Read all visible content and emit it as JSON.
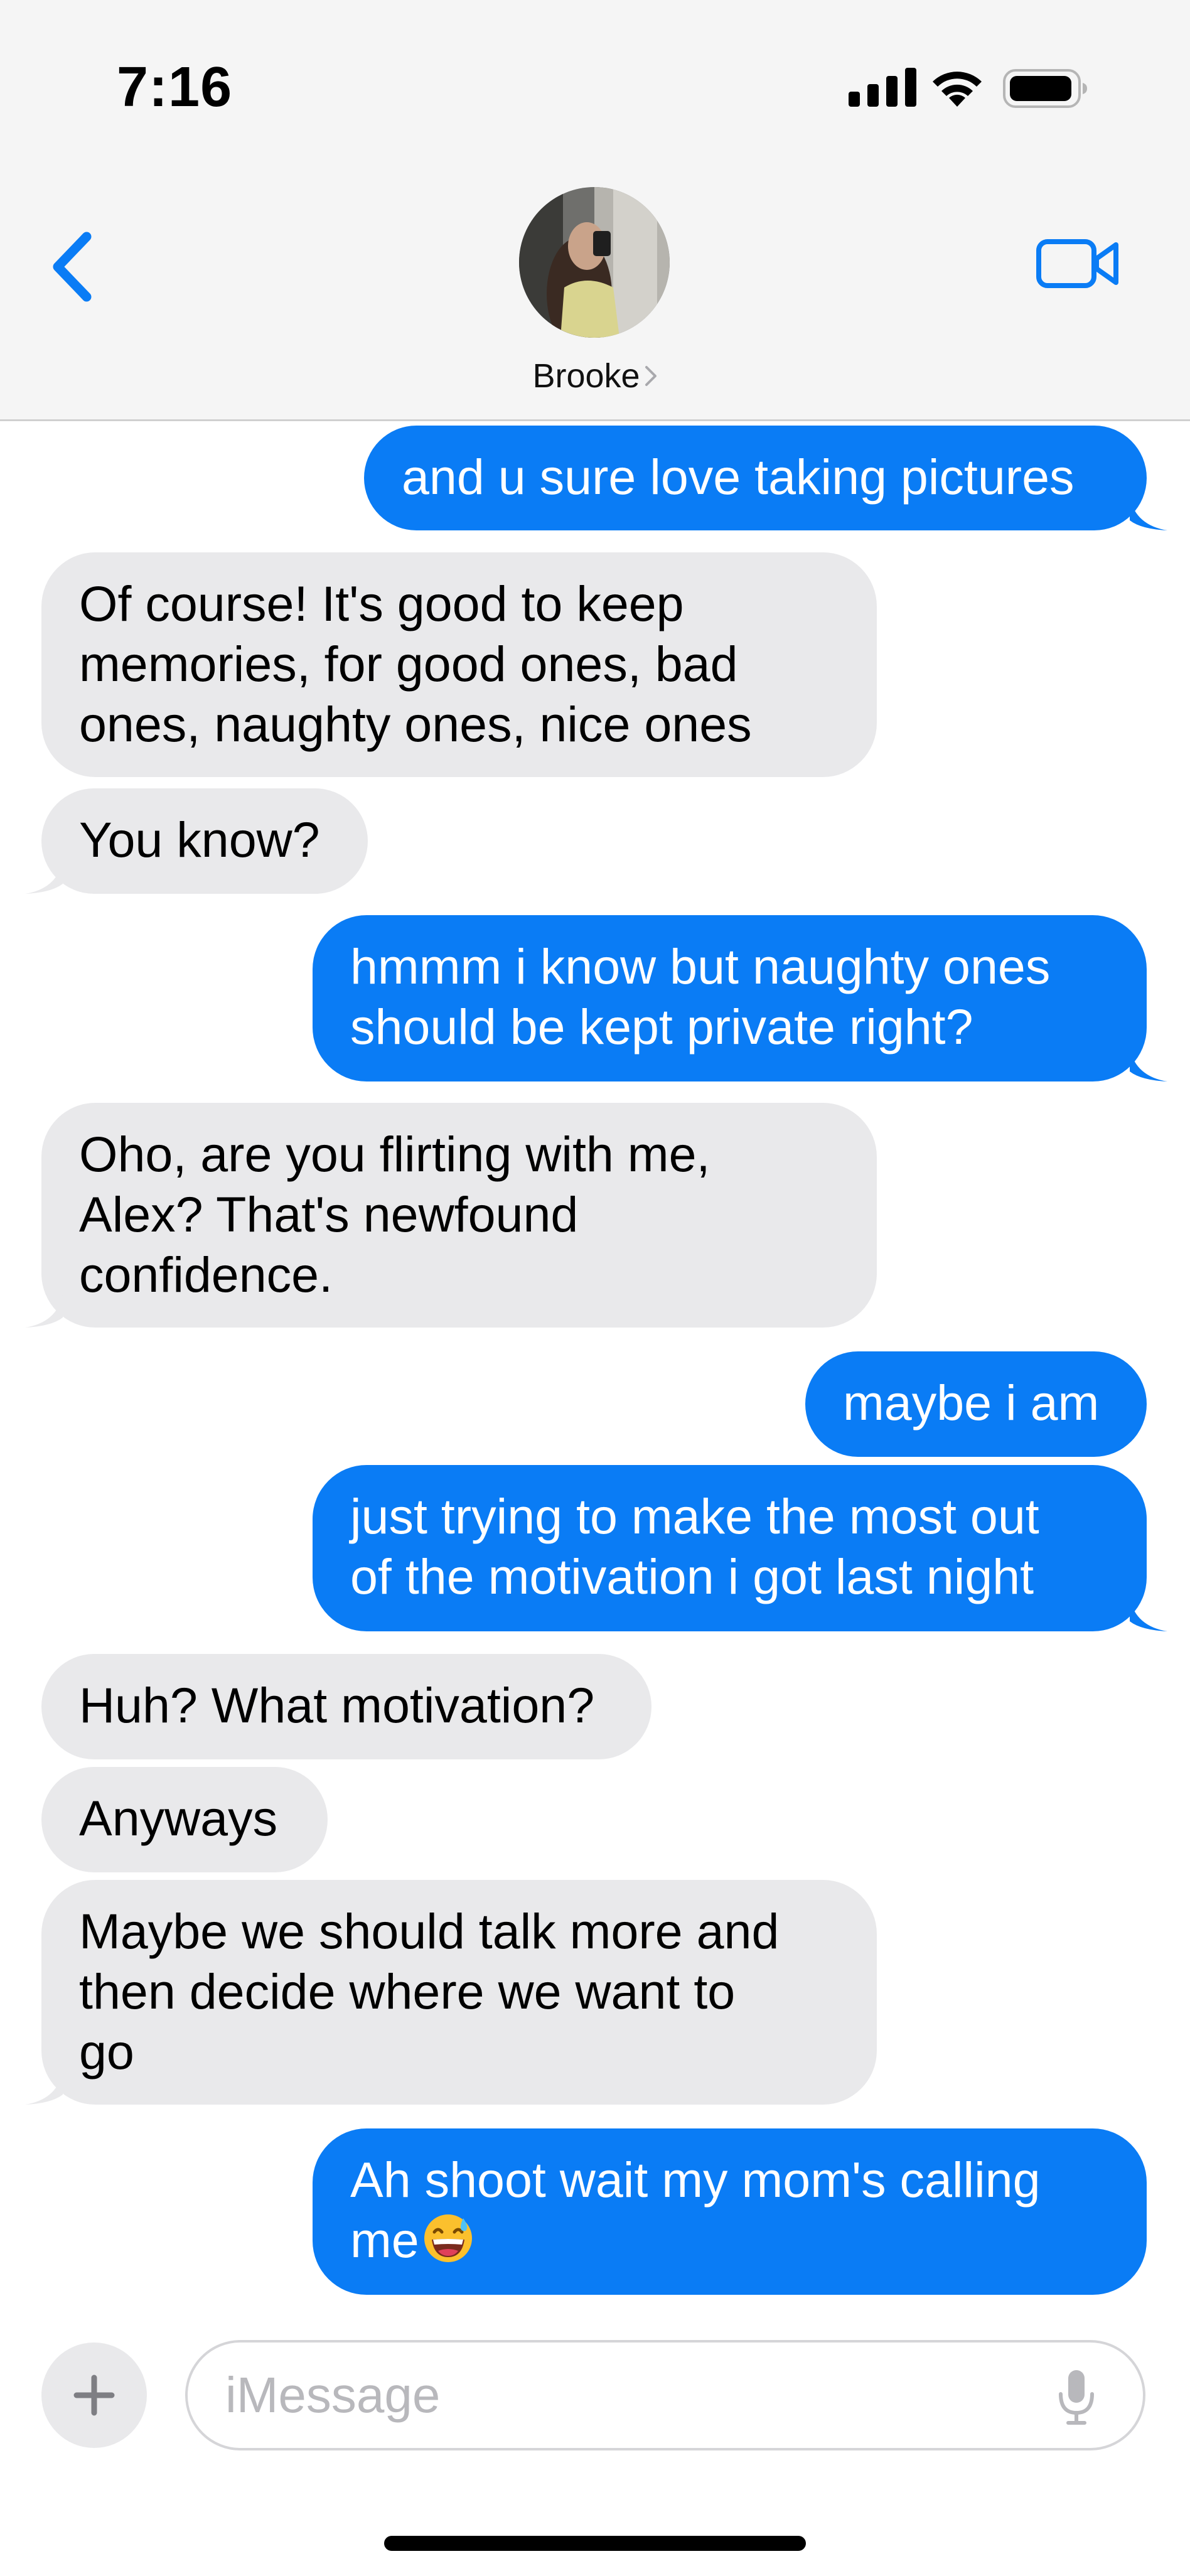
{
  "status_bar": {
    "time": "7:16"
  },
  "header": {
    "contact_name": "Brooke",
    "chevron": "›"
  },
  "icons": {
    "back": "chevron-left-icon",
    "video": "video-camera-icon",
    "plus": "plus-icon",
    "mic": "microphone-icon",
    "signal": "cellular-signal-icon",
    "wifi": "wifi-icon",
    "battery": "battery-icon",
    "emoji": "grinning-sweat-emoji"
  },
  "colors": {
    "sent_bubble": "#0a7cf5",
    "received_bubble": "#e9e9eb",
    "accent": "#0a7cf5"
  },
  "messages": [
    {
      "from": "me",
      "lines": [
        "and u sure love taking pictures"
      ]
    },
    {
      "from": "them",
      "lines": [
        "Of course! It's good to keep",
        "memories, for good ones, bad",
        "ones, naughty ones, nice ones"
      ]
    },
    {
      "from": "them",
      "lines": [
        "You know?"
      ]
    },
    {
      "from": "me",
      "lines": [
        "hmmm i know but naughty ones",
        "should be kept private right?"
      ]
    },
    {
      "from": "them",
      "lines": [
        "Oho, are you flirting with me,",
        "Alex? That's newfound",
        "confidence."
      ]
    },
    {
      "from": "me",
      "lines": [
        "maybe i am"
      ]
    },
    {
      "from": "me",
      "lines": [
        "just trying to make the most out",
        "of the motivation i got last night"
      ]
    },
    {
      "from": "them",
      "lines": [
        "Huh? What motivation?"
      ]
    },
    {
      "from": "them",
      "lines": [
        "Anyways"
      ]
    },
    {
      "from": "them",
      "lines": [
        "Maybe we should talk more and",
        "then decide where we want to",
        "go"
      ]
    },
    {
      "from": "me",
      "lines": [
        "Ah shoot wait my mom's calling",
        "me"
      ],
      "emoji": "😅"
    }
  ],
  "composer": {
    "placeholder": "iMessage"
  }
}
